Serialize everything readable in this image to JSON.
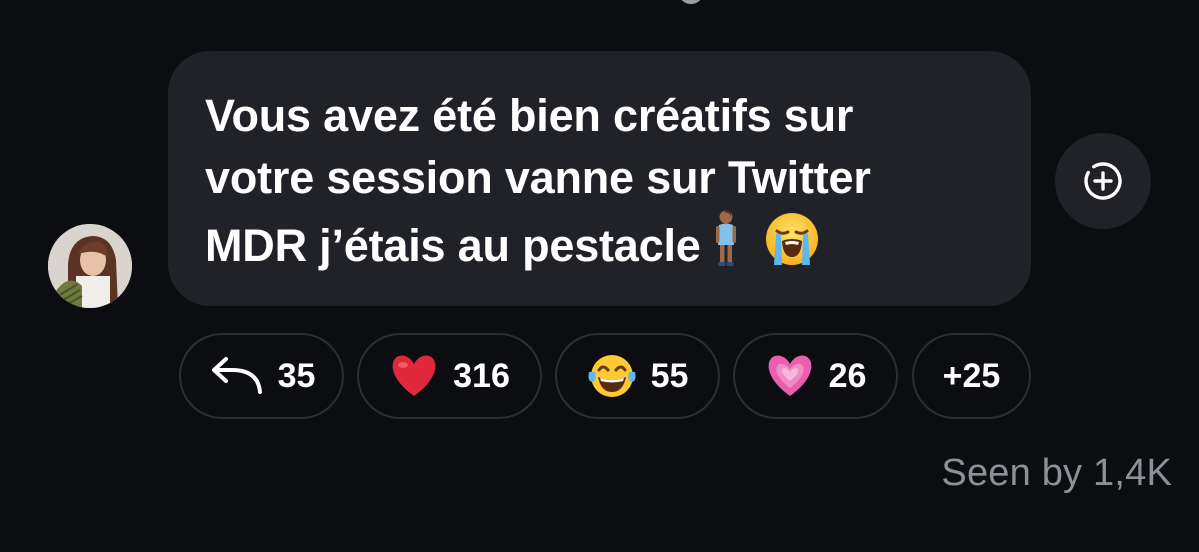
{
  "message": {
    "text": "Vous avez été bien créatifs sur\nvotre session vanne sur Twitter\nMDR j’étais au pestacle",
    "emojis": [
      "person-standing-icon",
      "loudly-crying-face-icon"
    ]
  },
  "reactions": [
    {
      "icon": "reply-arrow-icon",
      "count": "35"
    },
    {
      "icon": "red-heart-icon",
      "count": "316"
    },
    {
      "icon": "tears-of-joy-icon",
      "count": "55"
    },
    {
      "icon": "growing-pink-heart-icon",
      "count": "26"
    },
    {
      "icon": "",
      "count": "+25"
    }
  ],
  "footer": {
    "seen_label": "Seen by 1,4K"
  },
  "colors": {
    "background": "#0c0d11",
    "bubble": "#212227",
    "chip_border": "#2c2e33",
    "seen_text": "#8e9097",
    "heart_red": "#e0283a",
    "heart_pink": "#e85fb0"
  }
}
